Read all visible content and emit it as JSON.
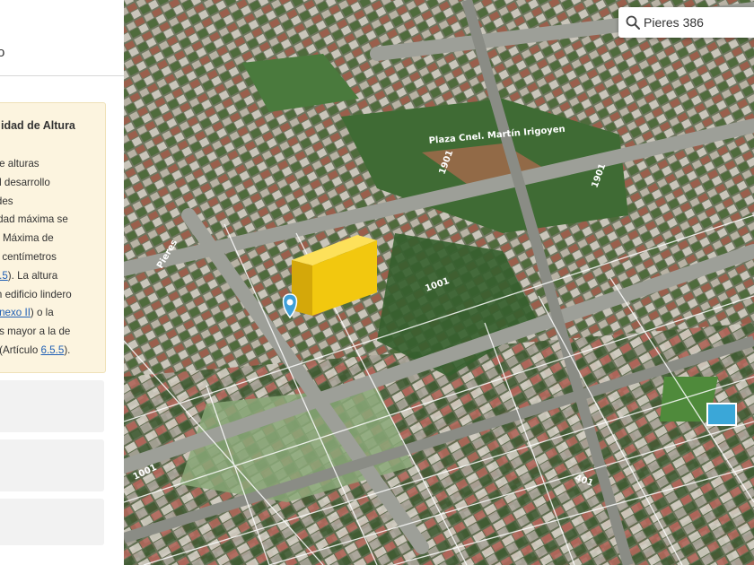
{
  "panel": {
    "header_fragment": "o",
    "info_title": "idad de Altura",
    "info_lines": [
      {
        "parts": [
          {
            "text": "d de alturas",
            "link": false
          }
        ]
      },
      {
        "parts": [
          {
            "text": "a el desarrollo",
            "link": false
          }
        ]
      },
      {
        "parts": [
          {
            "text": "dades",
            "link": false
          }
        ]
      },
      {
        "parts": [
          {
            "text": "bilidad máxima se",
            "link": false
          }
        ]
      },
      {
        "parts": [
          {
            "text": "ura Máxima de",
            "link": false
          }
        ]
      },
      {
        "parts": [
          {
            "text": "nta centímetros",
            "link": false
          }
        ]
      },
      {
        "parts": [
          {
            "text": "6.2.5",
            "link": true
          },
          {
            "text": "). La altura",
            "link": false
          }
        ]
      },
      {
        "parts": [
          {
            "text": "gún edificio lindero",
            "link": false
          }
        ]
      },
      {
        "parts": [
          {
            "text": "s Anexo II",
            "link": true
          },
          {
            "text": ") o la",
            "link": false
          }
        ]
      },
      {
        "parts": [
          {
            "text": "o es mayor a la de",
            "link": false
          }
        ]
      },
      {
        "parts": [
          {
            "text": "ad (Artículo ",
            "link": false
          },
          {
            "text": "6.5.5",
            "link": true
          },
          {
            "text": ").",
            "link": false
          }
        ]
      }
    ]
  },
  "search": {
    "value": "Pieres 386",
    "icon": "search-icon"
  },
  "map": {
    "street_labels": [
      "Pieres",
      "1001",
      "1001",
      "401",
      "1901",
      "1901"
    ],
    "park_label": "Plaza Cnel. Martín Irigoyen",
    "marker_icon": "location-pin-icon",
    "building_color": "#f2c80f"
  }
}
